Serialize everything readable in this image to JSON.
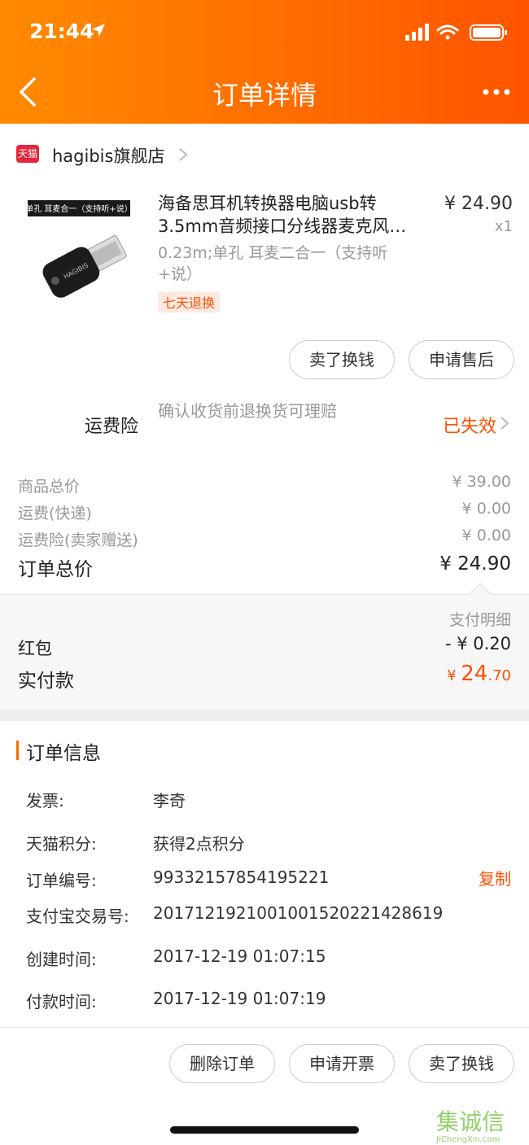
{
  "status_bar": {
    "time": "21:44"
  },
  "nav": {
    "title": "订单详情"
  },
  "shop": {
    "badge": "天猫",
    "name": "hagibis旗舰店"
  },
  "product": {
    "image_label": "单孔 耳麦合一（支持听+说）",
    "brand": "HAGIBIS",
    "title_line1": "海备思耳机转换器电脑usb转",
    "title_line2": "3.5mm音频接口分线器麦克风…",
    "spec": "0.23m;单孔 耳麦二合一（支持听+说）",
    "tag": "七天退换",
    "price": "¥ 24.90",
    "qty": "x1"
  },
  "item_actions": {
    "sell_label": "卖了换钱",
    "after_sale_label": "申请售后"
  },
  "insurance": {
    "label": "运费险",
    "desc": "确认收货前退换货可理赔",
    "status": "已失效"
  },
  "summary": {
    "goods_total_label": "商品总价",
    "goods_total_value": "¥ 39.00",
    "shipping_label": "运费(快递)",
    "shipping_value": "¥ 0.00",
    "insurance_label": "运费险(卖家赠送)",
    "insurance_value": "¥ 0.00",
    "order_total_label": "订单总价",
    "order_total_value": "¥ 24.90"
  },
  "payment": {
    "detail_label": "支付明细",
    "hongbao_label": "红包",
    "hongbao_value": "- ¥ 0.20",
    "paid_label": "实付款",
    "paid_currency": "¥ ",
    "paid_int": "24",
    "paid_dec": ".70"
  },
  "order_info": {
    "title": "订单信息",
    "invoice_label": "发票:",
    "invoice_value": "李奇",
    "points_label": "天猫积分:",
    "points_value": "获得2点积分",
    "order_no_label": "订单编号:",
    "order_no_value": "99332157854195221",
    "copy_label": "复制",
    "alipay_label": "支付宝交易号:",
    "alipay_value": "2017121921001001520221428619",
    "created_label": "创建时间:",
    "created_value": "2017-12-19 01:07:15",
    "paid_time_label": "付款时间:",
    "paid_time_value": "2017-12-19 01:07:19"
  },
  "bottom_actions": {
    "delete_label": "删除订单",
    "invoice_label": "申请开票",
    "sell_label": "卖了换钱"
  },
  "watermark": {
    "text": "集诚信",
    "url": "JiChengXin.com"
  },
  "colors": {
    "accent": "#ff5000",
    "header_start": "#ff8a00",
    "header_end": "#ff5400"
  }
}
